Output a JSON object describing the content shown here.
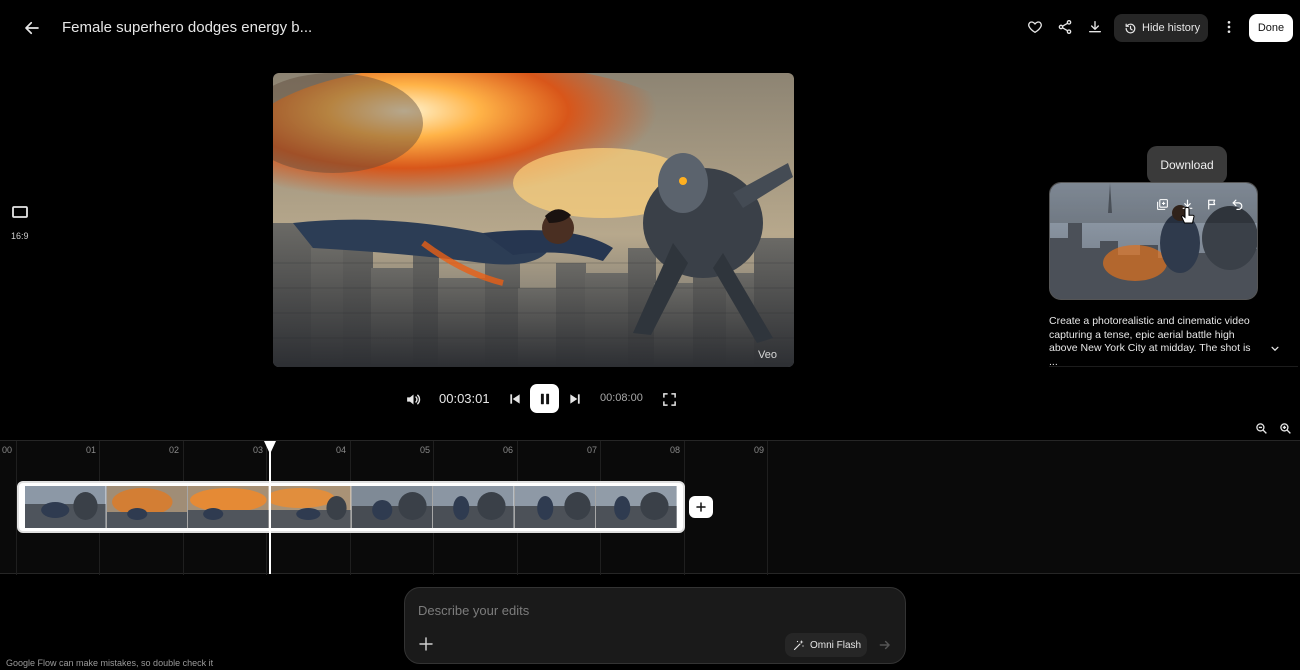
{
  "header": {
    "title": "Female superhero dodges energy b...",
    "hide_history_label": "Hide history",
    "done_label": "Done"
  },
  "aspect": {
    "label": "16:9"
  },
  "player": {
    "current_time": "00:03:01",
    "duration": "00:08:00",
    "watermark": "Veo"
  },
  "history": {
    "tooltip": "Download",
    "description": "Create a photorealistic and cinematic video capturing a tense, epic aerial battle high above New York City at midday. The shot is ..."
  },
  "timeline": {
    "ticks": [
      "00",
      "01",
      "02",
      "03",
      "04",
      "05",
      "06",
      "07",
      "08",
      "09"
    ],
    "playhead_seconds": 3.01
  },
  "prompt": {
    "placeholder": "Describe your edits",
    "model_label": "Omni Flash"
  },
  "footer": {
    "disclaimer": "Google Flow can make mistakes, so double check it"
  }
}
